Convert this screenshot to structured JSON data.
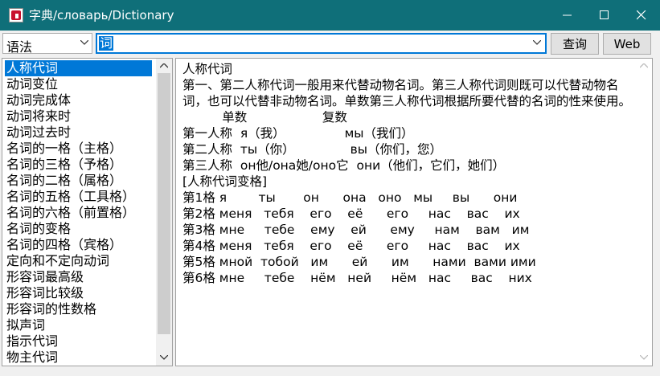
{
  "window": {
    "title": "字典/словарь/Dictionary",
    "minimize_icon": "minimize-icon",
    "maximize_icon": "maximize-icon",
    "close_icon": "close-icon",
    "titlebar_color": "#0f6f79"
  },
  "toolbar": {
    "category_value": "语法",
    "search_value": "词",
    "lookup_label": "查询",
    "web_label": "Web"
  },
  "sidebar": {
    "items": [
      "人称代词",
      "动词变位",
      "动词完成体",
      "动词将来时",
      "动词过去时",
      "名词的一格（主格）",
      "名词的三格（予格）",
      "名词的二格（属格）",
      "名词的五格（工具格）",
      "名词的六格（前置格）",
      "名词的变格",
      "名词的四格（宾格）",
      "定向和不定向动词",
      "形容词最高级",
      "形容词比较级",
      "形容词的性数格",
      "拟声词",
      "指示代词",
      "物主代词"
    ],
    "selected_index": 0
  },
  "content": {
    "heading": "人称代词",
    "intro": "第一、第二人称代词一般用来代替动物名词。第三人称代词则既可以代替动物名词，也可以代替非动物名词。单数第三人称代词根据所要代替的名词的性来使用。",
    "lines": [
      "          单数                   复数",
      "第一人称  я（我）               мы（我们）",
      "第二人称  ты（你）              вы（你们，您）",
      "第三人称  он他/она她/оно它  они（他们，它们，她们）",
      "[人称代词变格]",
      "第1格 я        ты       он      она   оно   мы     вы      они",
      "第2格 меня   тебя    его    её      его     нас    вас    их",
      "第3格 мне     тебе    ему    ей      ему     нам    вам   им",
      "第4格 меня   тебя    его    её      его     нас    вас    их",
      "第5格 мной  тобой   им      ей      им      нами  вами ими",
      "第6格 мне     тебе    нём   ней     нём   нас     вас    них"
    ]
  }
}
